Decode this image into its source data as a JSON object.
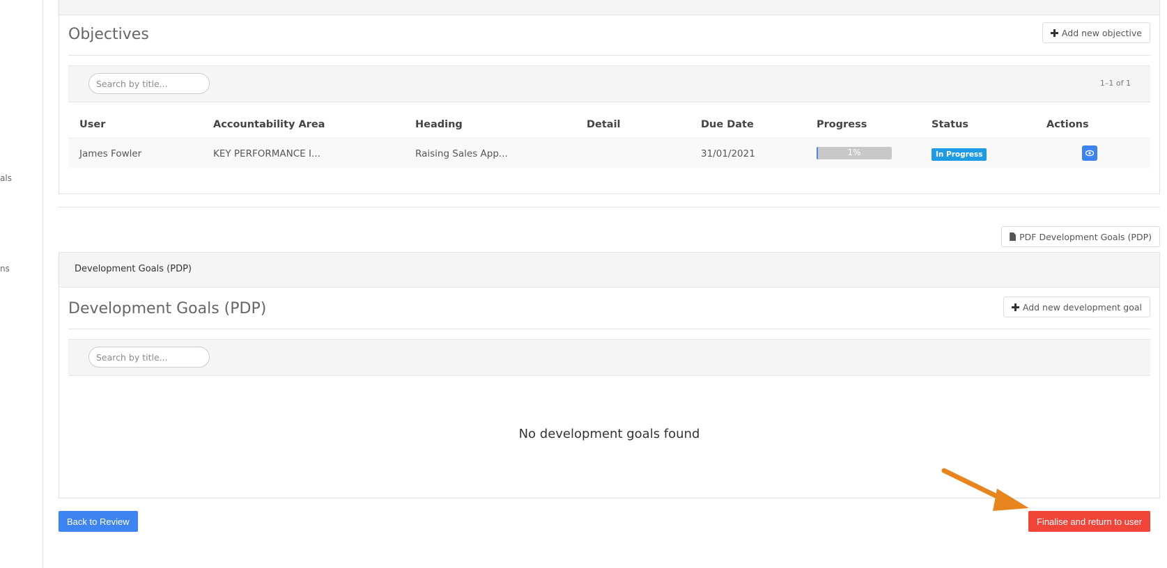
{
  "sidebar": {
    "fragments": [
      "als",
      "ns"
    ]
  },
  "objectives": {
    "title": "Objectives",
    "add_button": "Add new objective",
    "search_placeholder": "Search by title...",
    "pager": "1–1 of 1",
    "columns": [
      "User",
      "Accountability Area",
      "Heading",
      "Detail",
      "Due Date",
      "Progress",
      "Status",
      "Actions"
    ],
    "rows": [
      {
        "user": "James Fowler",
        "area": "KEY PERFORMANCE I...",
        "heading": "Raising Sales App...",
        "detail": "",
        "due_date": "31/01/2021",
        "progress_label": "1%",
        "progress_value": 0.01,
        "status": "In Progress"
      }
    ]
  },
  "pdf_button": "PDF Development Goals (PDP)",
  "development": {
    "tab_label": "Development Goals (PDP)",
    "title": "Development Goals (PDP)",
    "add_button": "Add new development goal",
    "search_placeholder": "Search by title...",
    "empty_message": "No development goals found"
  },
  "footer": {
    "back_button": "Back to Review",
    "finalise_button": "Finalise and return to user"
  },
  "colors": {
    "primary": "#3d84f0",
    "danger": "#f2453a",
    "status_badge": "#1e9be4",
    "annotation_arrow": "#e8841e"
  }
}
